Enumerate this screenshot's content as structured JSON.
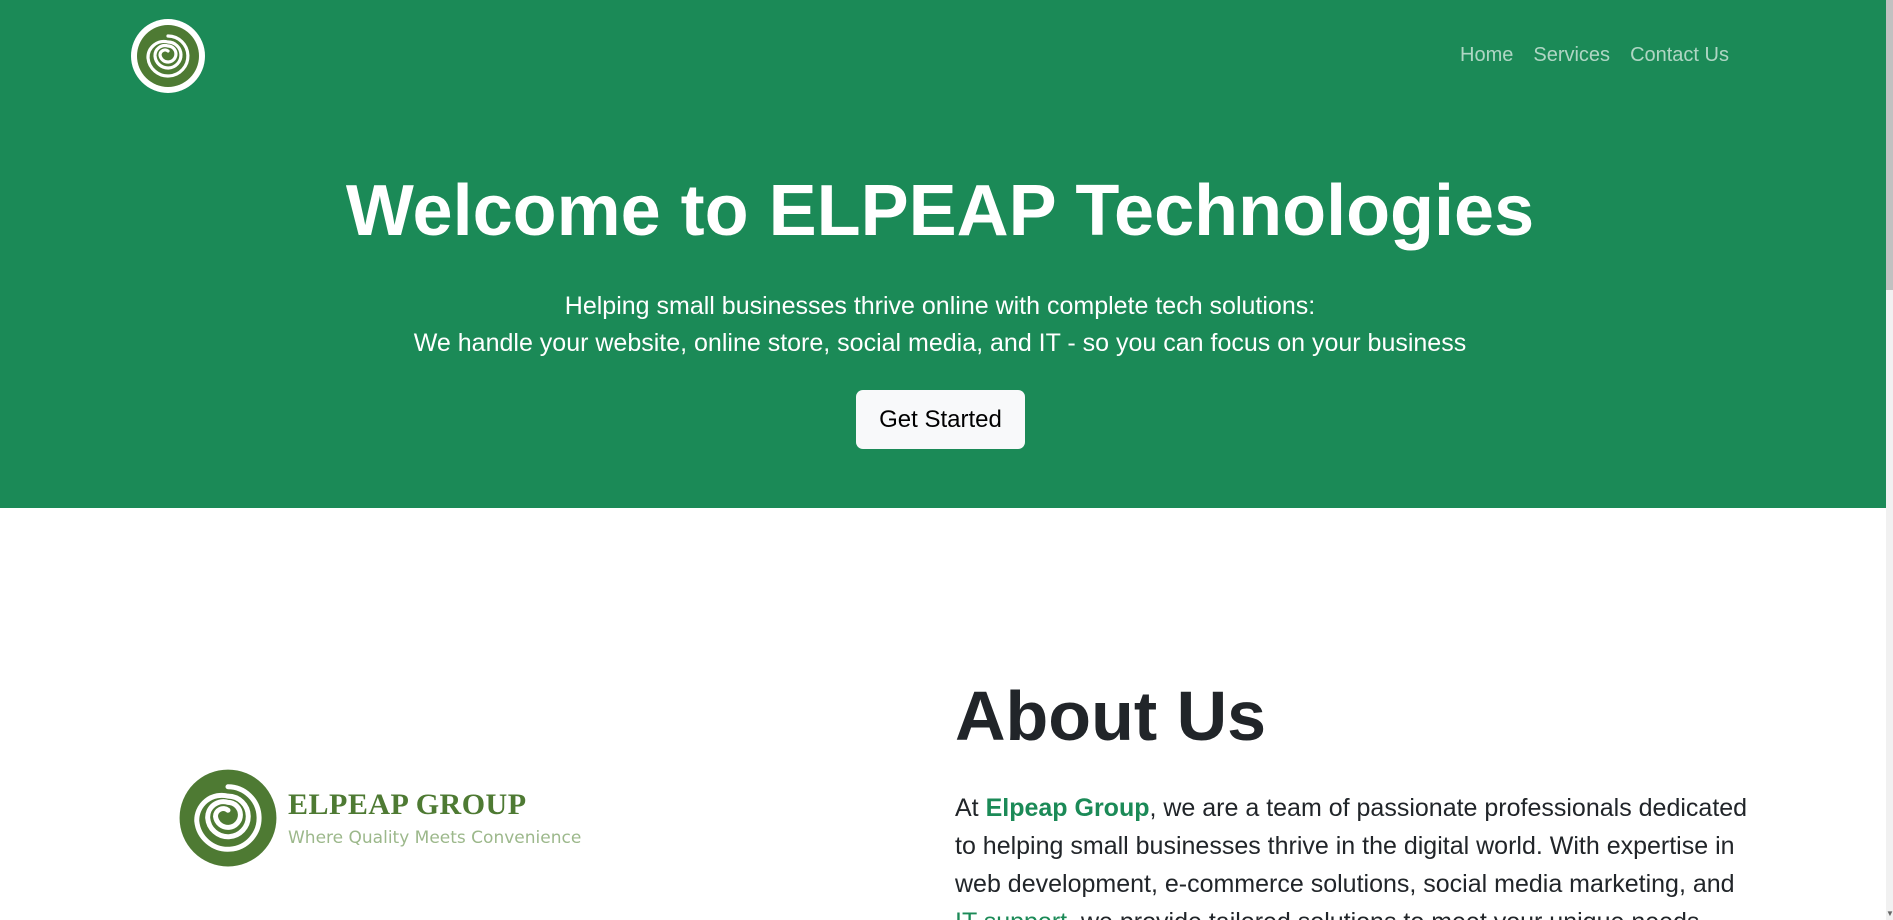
{
  "header": {
    "logo_icon": "spiral-logo-icon",
    "nav": [
      {
        "label": "Home"
      },
      {
        "label": "Services"
      },
      {
        "label": "Contact Us"
      }
    ]
  },
  "hero": {
    "title": "Welcome to ELPEAP Technologies",
    "subtitle_line1": "Helping small businesses thrive online with complete tech solutions:",
    "subtitle_line2": "We handle your website, online store, social media, and IT - so you can focus on your business",
    "cta_label": "Get Started"
  },
  "about": {
    "logo_name": "ELPEAP GROUP",
    "logo_tagline": "Where Quality Meets Convenience",
    "title": "About Us",
    "text_prefix": "At ",
    "brand": "Elpeap Group",
    "text_mid": ", we are a team of passionate professionals dedicated to helping small businesses thrive in the digital world. With expertise in web development, e-commerce solutions, social media marketing, and ",
    "link_text": "IT support",
    "text_suffix": ", we provide tailored solutions to meet your unique needs."
  },
  "colors": {
    "brand_green": "#1b8a57",
    "logo_green": "#4e7a33",
    "tagline_green": "#9cb88b"
  }
}
